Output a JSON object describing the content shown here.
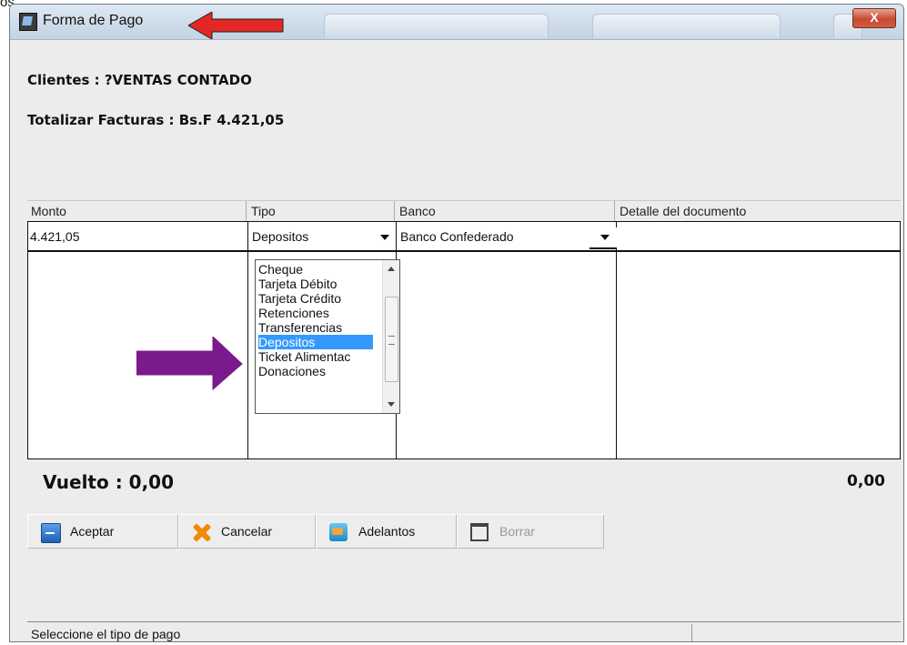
{
  "background_text": {
    "top": "os"
  },
  "window": {
    "title": "Forma de Pago",
    "close_label": "X"
  },
  "info": {
    "cliente": "Clientes  : ?VENTAS CONTADO",
    "totalizar": "Totalizar Facturas  : Bs.F 4.421,05"
  },
  "grid": {
    "headers": [
      "Monto",
      "Tipo",
      "Banco",
      "Detalle del documento"
    ],
    "row": {
      "monto": "4.421,05",
      "tipo": "Depositos",
      "banco": "Banco Confederado",
      "detalle": ""
    }
  },
  "tipo_dropdown": {
    "options": [
      "Cheque",
      "Tarjeta Débito",
      "Tarjeta Crédito",
      "Retenciones",
      "Transferencias",
      "Depositos",
      "Ticket Alimentac",
      "Donaciones"
    ],
    "selected": "Depositos"
  },
  "vuelto": {
    "label": "Vuelto : 0,00",
    "total": "0,00"
  },
  "buttons": {
    "aceptar": "Aceptar",
    "cancelar": "Cancelar",
    "adelantos": "Adelantos",
    "borrar": "Borrar"
  },
  "status": {
    "text": "Seleccione el tipo de pago"
  },
  "colors": {
    "annotation_red": "#e32626",
    "annotation_purple": "#7b1a8c",
    "selection": "#3399ff"
  }
}
